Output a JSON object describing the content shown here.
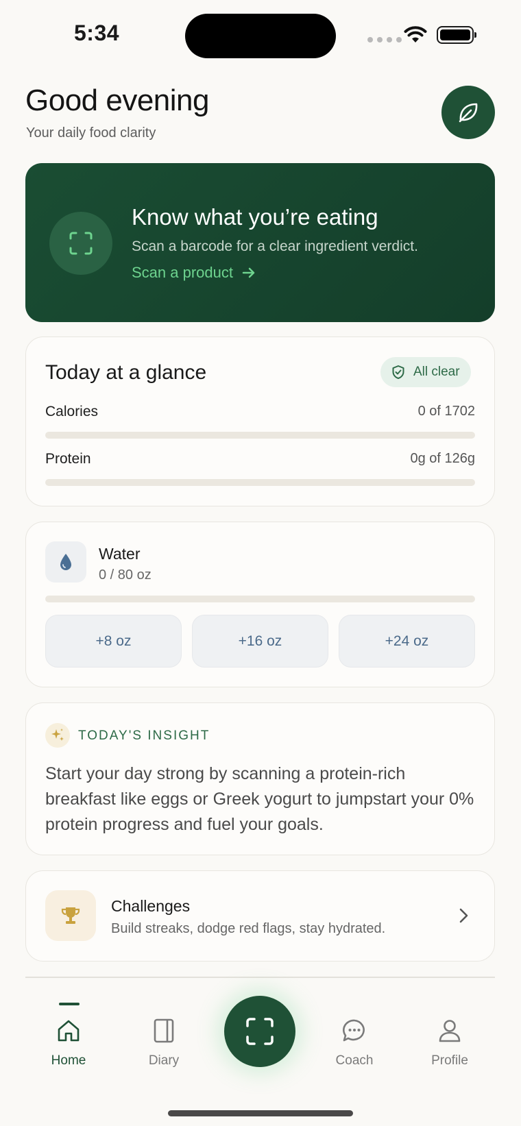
{
  "status_bar": {
    "time": "5:34"
  },
  "header": {
    "greeting": "Good evening",
    "subtitle": "Your daily food clarity"
  },
  "hero": {
    "title": "Know what you’re eating",
    "description": "Scan a barcode for a clear ingredient verdict.",
    "link_label": "Scan a product"
  },
  "glance": {
    "title": "Today at a glance",
    "badge": "All clear",
    "metrics": [
      {
        "label": "Calories",
        "value": "0 of 1702",
        "progress": 0
      },
      {
        "label": "Protein",
        "value": "0g of 126g",
        "progress": 0
      }
    ]
  },
  "water": {
    "label": "Water",
    "amount": "0 / 80 oz",
    "progress": 0,
    "buttons": [
      "+8 oz",
      "+16 oz",
      "+24 oz"
    ]
  },
  "insight": {
    "label": "TODAY'S INSIGHT",
    "text": "Start your day strong by scanning a protein-rich breakfast like eggs or Greek yogurt to jumpstart your 0% protein progress and fuel your goals."
  },
  "challenges": {
    "title": "Challenges",
    "description": "Build streaks, dodge red flags, stay hydrated."
  },
  "tabbar": {
    "items": [
      {
        "label": "Home",
        "icon": "home-icon",
        "active": true
      },
      {
        "label": "Diary",
        "icon": "book-icon",
        "active": false
      },
      {
        "label": "Coach",
        "icon": "chat-icon",
        "active": false
      },
      {
        "label": "Profile",
        "icon": "person-icon",
        "active": false
      }
    ]
  },
  "colors": {
    "brand_green": "#1f5136",
    "accent_green": "#6ed48f",
    "background": "#faf9f6"
  }
}
